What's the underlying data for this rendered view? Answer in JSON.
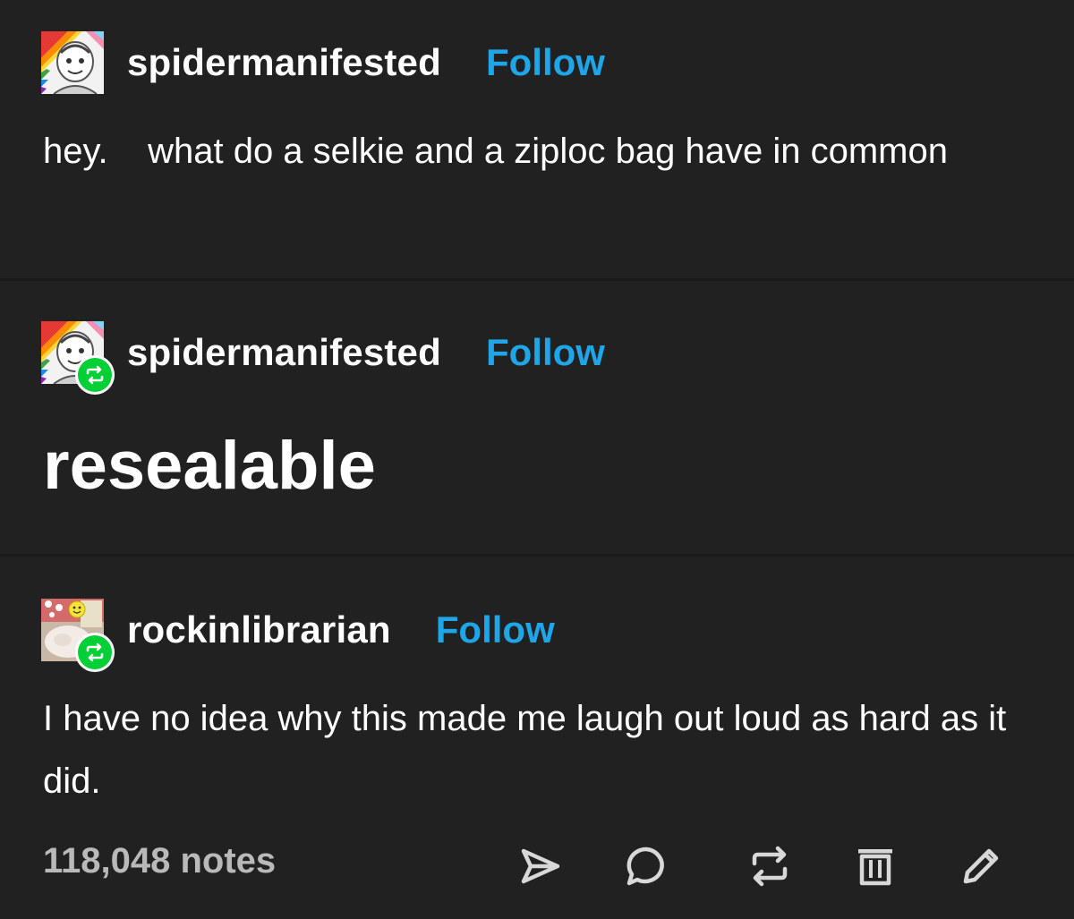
{
  "posts": [
    {
      "username": "spidermanifested",
      "follow_label": "Follow",
      "text": "hey.    what do a selkie and a ziploc bag have in common"
    },
    {
      "username": "spidermanifested",
      "follow_label": "Follow",
      "text": "resealable"
    },
    {
      "username": "rockinlibrarian",
      "follow_label": "Follow",
      "text": "I have no idea why this made me laugh out loud as hard as it did."
    }
  ],
  "footer": {
    "notes": "118,048 notes",
    "icons": [
      "share-icon",
      "reply-icon",
      "reblog-icon",
      "delete-icon",
      "edit-icon"
    ]
  },
  "colors": {
    "background": "#212121",
    "text": "#ffffff",
    "follow": "#1ea6e8",
    "reblog_badge": "#00cf35",
    "icon": "#d8d8d8",
    "notes": "#b9b9b9"
  }
}
